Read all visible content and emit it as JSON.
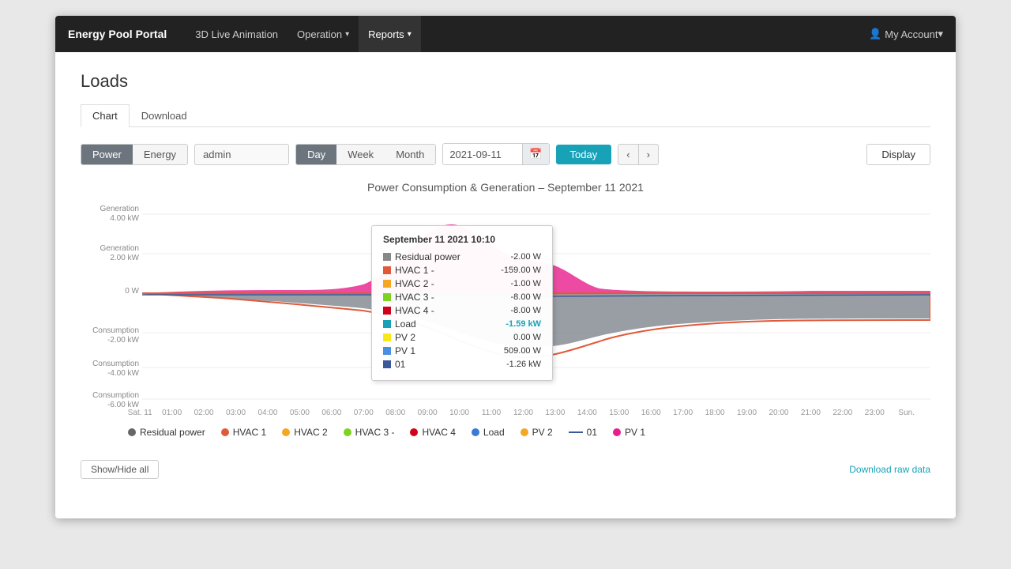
{
  "navbar": {
    "brand": "Energy Pool Portal",
    "items": [
      {
        "label": "3D Live Animation",
        "active": false
      },
      {
        "label": "Operation",
        "active": false,
        "has_caret": true
      },
      {
        "label": "Reports",
        "active": true,
        "has_caret": true
      }
    ],
    "account": "My Account"
  },
  "page": {
    "title": "Loads"
  },
  "tabs": [
    {
      "label": "Chart",
      "active": true
    },
    {
      "label": "Download",
      "active": false
    }
  ],
  "toolbar": {
    "power_label": "Power",
    "energy_label": "Energy",
    "admin_value": "admin",
    "day_label": "Day",
    "week_label": "Week",
    "month_label": "Month",
    "date_value": "2021-09-11",
    "today_label": "Today",
    "prev_arrow": "‹",
    "next_arrow": "›",
    "display_label": "Display"
  },
  "chart": {
    "title": "Power Consumption & Generation – September 11 2021",
    "x_labels": [
      "Sat. 11",
      "01:00",
      "02:00",
      "03:00",
      "04:00",
      "05:00",
      "06:00",
      "07:00",
      "08:00",
      "09:00",
      "10:00",
      "11:00",
      "12:00",
      "13:00",
      "14:00",
      "15:00",
      "16:00",
      "17:00",
      "18:00",
      "19:00",
      "20:00",
      "21:00",
      "22:00",
      "23:00",
      "Sun."
    ],
    "y_labels": [
      {
        "label": "Generation 4.00 kW",
        "y": 0
      },
      {
        "label": "Generation 2.00 kW",
        "y": 1
      },
      {
        "label": "0 W",
        "y": 2
      },
      {
        "label": "Consumption -2.00 kW",
        "y": 3
      },
      {
        "label": "Consumption -4.00 kW",
        "y": 4
      },
      {
        "label": "Consumption -6.00 kW",
        "y": 5
      }
    ]
  },
  "tooltip": {
    "title": "September 11 2021 10:10",
    "rows": [
      {
        "color": "#888",
        "label": "Residual power",
        "value": "-2.00 W"
      },
      {
        "color": "#e05a3a",
        "label": "HVAC 1 -",
        "value": "-159.00 W"
      },
      {
        "color": "#f5a623",
        "label": "HVAC 2 -",
        "value": "-1.00 W"
      },
      {
        "color": "#7ed321",
        "label": "HVAC 3 -",
        "value": "-8.00 W"
      },
      {
        "color": "#d0021b",
        "label": "HVAC 4 -",
        "value": "-8.00 W"
      },
      {
        "color": "#17a2b8",
        "label": "Load",
        "value": "-1.59 kW",
        "highlight": true
      },
      {
        "color": "#f8e71c",
        "label": "PV 2",
        "value": "0.00 W"
      },
      {
        "color": "#4a90e2",
        "label": "PV 1",
        "value": "509.00 W"
      },
      {
        "color": "#3b5998",
        "label": "01",
        "value": "-1.26 kW"
      }
    ]
  },
  "legend": [
    {
      "type": "dot",
      "color": "#666",
      "label": "Residual power"
    },
    {
      "type": "dot",
      "color": "#e05a3a",
      "label": "HVAC 1"
    },
    {
      "type": "dot",
      "color": "#f5a623",
      "label": "HVAC 2"
    },
    {
      "type": "dot",
      "color": "#7ed321",
      "label": "HVAC 3 -"
    },
    {
      "type": "dot",
      "color": "#d0021b",
      "label": "HVAC 4"
    },
    {
      "type": "dot",
      "color": "#3a7bd5",
      "label": "Load"
    },
    {
      "type": "dot",
      "color": "#f5a623",
      "label": "PV 2"
    },
    {
      "type": "line",
      "color": "#3b5998",
      "label": "01"
    },
    {
      "type": "dot",
      "color": "#e91e8c",
      "label": "PV 1"
    }
  ],
  "buttons": {
    "show_hide_all": "Show/Hide all",
    "download_raw": "Download raw data"
  }
}
